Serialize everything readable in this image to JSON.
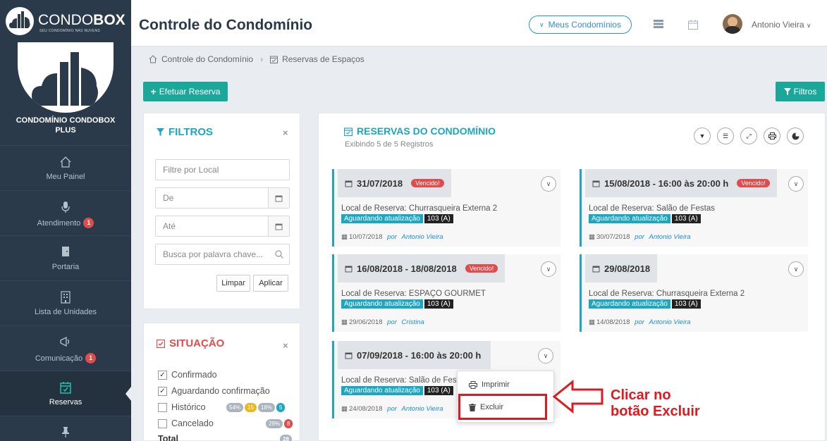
{
  "header": {
    "logo_main": "CONDO",
    "logo_bold": "BOX",
    "logo_tagline": "SEU CONDOMÍNIO NAS NUVENS",
    "title": "Controle do Condomínio",
    "meus_condominios": "Meus Condomínios",
    "user_name": "Antonio Vieira"
  },
  "sidebar": {
    "condo_name_line1": "CONDOMÍNIO CONDOBOX",
    "condo_name_line2": "PLUS",
    "items": [
      {
        "label": "Meu Painel",
        "icon": "home-icon",
        "badge": ""
      },
      {
        "label": "Atendimento",
        "icon": "microphone-icon",
        "badge": "1"
      },
      {
        "label": "Portaria",
        "icon": "door-icon",
        "badge": ""
      },
      {
        "label": "Lista de Unidades",
        "icon": "building-icon",
        "badge": ""
      },
      {
        "label": "Comunicação",
        "icon": "megaphone-icon",
        "badge": "1"
      },
      {
        "label": "Reservas",
        "icon": "calendar-check-icon",
        "badge": ""
      },
      {
        "label": "",
        "icon": "pin-icon",
        "badge": ""
      }
    ]
  },
  "breadcrumb": {
    "home": "Controle do Condomínio",
    "current": "Reservas de Espaços"
  },
  "actions": {
    "efetuar_reserva": "Efetuar Reserva",
    "filtros": "Filtros"
  },
  "filtros": {
    "title": "FILTROS",
    "local_placeholder": "Filtre por Local",
    "de_placeholder": "De",
    "ate_placeholder": "Até",
    "busca_placeholder": "Busca por palavra chave...",
    "limpar": "Limpar",
    "aplicar": "Aplicar"
  },
  "situacao": {
    "title": "SITUAÇÃO",
    "options": [
      {
        "label": "Confirmado",
        "checked": true
      },
      {
        "label": "Aguardando confirmação",
        "checked": true
      },
      {
        "label": "Histórico",
        "checked": false
      },
      {
        "label": "Cancelado",
        "checked": false
      }
    ],
    "historico_pills": [
      "54%",
      "15",
      "18%",
      "5"
    ],
    "cancelado_pills": [
      "29%",
      "8"
    ],
    "total_label": "Total",
    "total_pill": "28"
  },
  "reservas": {
    "title": "RESERVAS DO CONDOMÍNIO",
    "subtitle": "Exibindo 5 de 5 Registros",
    "vencido_label": "Vencido!",
    "por_label": "por",
    "cards": [
      {
        "date": "31/07/2018",
        "vencido": true,
        "local": "Local de Reserva: Churrasqueira Externa 2",
        "status": "Aguardando atualização",
        "unit": "103 (A)",
        "created": "10/07/2018",
        "author": "Antonio Vieira"
      },
      {
        "date": "15/08/2018 - 16:00 às 20:00 h",
        "vencido": true,
        "local": "Local de Reserva: Salão de Festas",
        "status": "Aguardando atualização",
        "unit": "103 (A)",
        "created": "30/07/2018",
        "author": "Antonio Vieira"
      },
      {
        "date": "16/08/2018 - 18/08/2018",
        "vencido": true,
        "local": "Local de Reserva: ESPAÇO GOURMET",
        "status": "Aguardando atualização",
        "unit": "103 (A)",
        "created": "29/06/2018",
        "author": "Cristina"
      },
      {
        "date": "29/08/2018",
        "vencido": false,
        "local": "Local de Reserva: Churrasqueira Externa 2",
        "status": "Aguardando atualização",
        "unit": "103 (A)",
        "created": "14/08/2018",
        "author": "Antonio Vieira"
      },
      {
        "date": "07/09/2018 - 16:00 às 20:00 h",
        "vencido": false,
        "local": "Local de Reserva: Salão de Fest",
        "status": "Aguardando atualização",
        "unit": "103 (A)",
        "created": "24/08/2018",
        "author": "Antonio Vieira"
      }
    ]
  },
  "dropdown": {
    "imprimir": "Imprimir",
    "excluir": "Excluir"
  },
  "annotation": {
    "line1": "Clicar no",
    "line2": "botão Excluir",
    "color": "#e0191f"
  },
  "colors": {
    "accent": "#1ba79a",
    "sidebar": "#2b3a4a",
    "info": "#1ba7c2",
    "danger": "#e04b4b"
  }
}
